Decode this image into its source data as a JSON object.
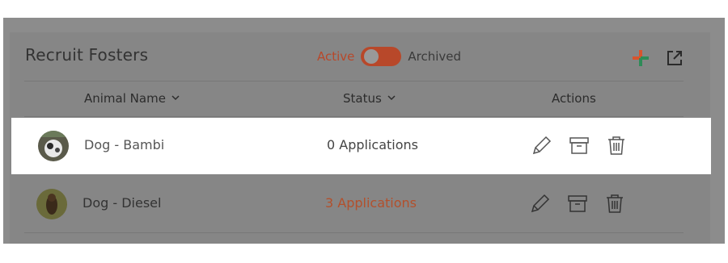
{
  "card": {
    "title": "Recruit Fosters"
  },
  "toggle": {
    "active_label": "Active",
    "archived_label": "Archived"
  },
  "header_icons": {
    "add": "plus-icon",
    "open": "external-link-icon",
    "add_colors": [
      "#d9532c",
      "#2e8b57"
    ]
  },
  "columns": {
    "animal_name": "Animal Name",
    "status": "Status",
    "actions": "Actions"
  },
  "rows": [
    {
      "name": "Dog - Bambi",
      "status": "0 Applications",
      "highlighted": true
    },
    {
      "name": "Dog - Diesel",
      "status": "3 Applications",
      "highlighted": false
    }
  ],
  "colors": {
    "accent": "#b8482a",
    "overlay": "#868686"
  }
}
